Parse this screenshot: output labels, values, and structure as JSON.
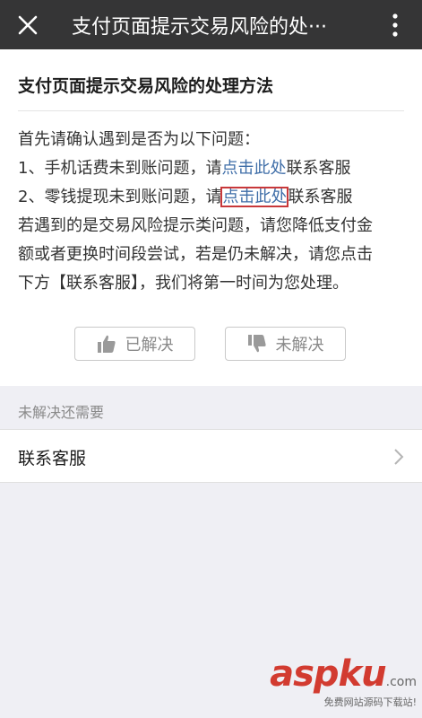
{
  "header": {
    "title": "支付页面提示交易风险的处···"
  },
  "article": {
    "title": "支付页面提示交易风险的处理方法",
    "lines": [
      {
        "before": "首先请确认遇到是否为以下问题：",
        "link": "",
        "after": ""
      },
      {
        "before": "1、手机话费未到账问题，请",
        "link": "点击此处",
        "after": "联系客服"
      },
      {
        "before": "2、零钱提现未到账问题，请",
        "link": "点击此处",
        "after": "联系客服"
      },
      {
        "before": "若遇到的是交易风险提示类问题，请您降低支付金",
        "link": "",
        "after": ""
      },
      {
        "before": "额或者更换时间段尝试，若是仍未解决，请您点击",
        "link": "",
        "after": ""
      },
      {
        "before": "下方【联系客服】，我们将第一时间为您处理。",
        "link": "",
        "after": ""
      }
    ]
  },
  "feedback": {
    "solved_label": "已解决",
    "unsolved_label": "未解决"
  },
  "section": {
    "label": "未解决还需要"
  },
  "menu": {
    "contact_label": "联系客服"
  },
  "watermark": {
    "main": "aspku",
    "suffix": ".com",
    "sub": "免费网站源码下载站!"
  },
  "colors": {
    "topbar": "#353536",
    "link": "#3f6ea8",
    "highlight_box": "#c8383a",
    "watermark": "#d23b30"
  }
}
